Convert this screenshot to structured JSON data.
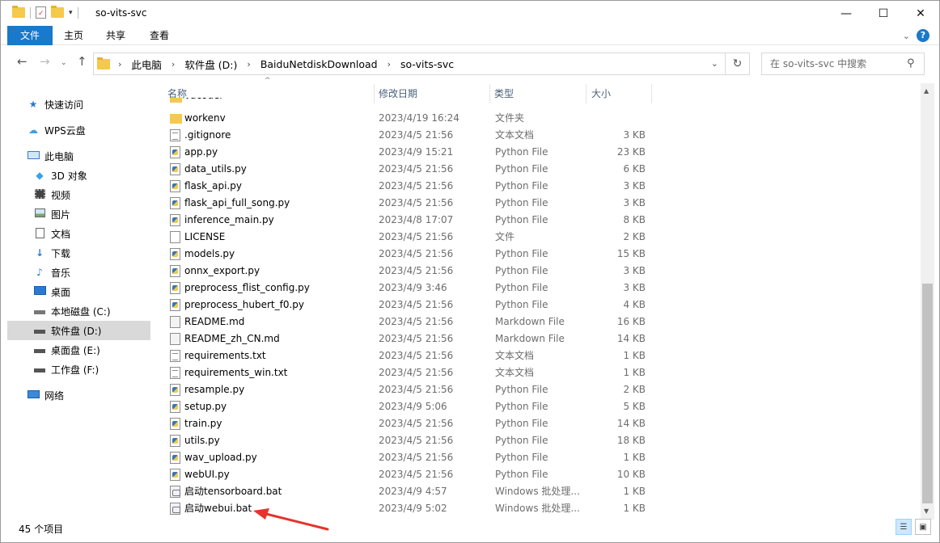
{
  "window": {
    "title": "so-vits-svc",
    "controls": [
      "—",
      "☐",
      "✕"
    ]
  },
  "ribbon": {
    "tabs": [
      "文件",
      "主页",
      "共享",
      "查看"
    ]
  },
  "address": {
    "crumbs": [
      "此电脑",
      "软件盘 (D:)",
      "BaiduNetdiskDownload",
      "so-vits-svc"
    ]
  },
  "search": {
    "placeholder": "在 so-vits-svc 中搜索"
  },
  "sidebar": {
    "items": [
      {
        "label": "快速访问",
        "icon": "star-icon"
      },
      {
        "label": "WPS云盘",
        "icon": "cloud-icon"
      },
      {
        "label": "此电脑",
        "icon": "computer-icon"
      },
      {
        "label": "3D 对象",
        "icon": "cube-icon"
      },
      {
        "label": "视频",
        "icon": "video-icon"
      },
      {
        "label": "图片",
        "icon": "picture-icon"
      },
      {
        "label": "文档",
        "icon": "document-icon"
      },
      {
        "label": "下载",
        "icon": "download-icon"
      },
      {
        "label": "音乐",
        "icon": "music-icon"
      },
      {
        "label": "桌面",
        "icon": "desktop-icon"
      },
      {
        "label": "本地磁盘 (C:)",
        "icon": "drive-icon"
      },
      {
        "label": "软件盘 (D:)",
        "icon": "drive-icon"
      },
      {
        "label": "桌面盘 (E:)",
        "icon": "drive-icon"
      },
      {
        "label": "工作盘 (F:)",
        "icon": "drive-icon"
      },
      {
        "label": "网络",
        "icon": "network-icon"
      }
    ]
  },
  "columns": {
    "name": "名称",
    "date": "修改日期",
    "type": "类型",
    "size": "大小"
  },
  "files": [
    {
      "name": "workenv",
      "date": "2023/4/19 16:24",
      "type": "文件夹",
      "size": "",
      "icon": "folder"
    },
    {
      "name": ".gitignore",
      "date": "2023/4/5 21:56",
      "type": "文本文档",
      "size": "3 KB",
      "icon": "txt"
    },
    {
      "name": "app.py",
      "date": "2023/4/9 15:21",
      "type": "Python File",
      "size": "23 KB",
      "icon": "py"
    },
    {
      "name": "data_utils.py",
      "date": "2023/4/5 21:56",
      "type": "Python File",
      "size": "6 KB",
      "icon": "py"
    },
    {
      "name": "flask_api.py",
      "date": "2023/4/5 21:56",
      "type": "Python File",
      "size": "3 KB",
      "icon": "py"
    },
    {
      "name": "flask_api_full_song.py",
      "date": "2023/4/5 21:56",
      "type": "Python File",
      "size": "3 KB",
      "icon": "py"
    },
    {
      "name": "inference_main.py",
      "date": "2023/4/8 17:07",
      "type": "Python File",
      "size": "8 KB",
      "icon": "py"
    },
    {
      "name": "LICENSE",
      "date": "2023/4/5 21:56",
      "type": "文件",
      "size": "2 KB",
      "icon": "blank"
    },
    {
      "name": "models.py",
      "date": "2023/4/5 21:56",
      "type": "Python File",
      "size": "15 KB",
      "icon": "py"
    },
    {
      "name": "onnx_export.py",
      "date": "2023/4/5 21:56",
      "type": "Python File",
      "size": "3 KB",
      "icon": "py"
    },
    {
      "name": "preprocess_flist_config.py",
      "date": "2023/4/9 3:46",
      "type": "Python File",
      "size": "3 KB",
      "icon": "py"
    },
    {
      "name": "preprocess_hubert_f0.py",
      "date": "2023/4/5 21:56",
      "type": "Python File",
      "size": "4 KB",
      "icon": "py"
    },
    {
      "name": "README.md",
      "date": "2023/4/5 21:56",
      "type": "Markdown File",
      "size": "16 KB",
      "icon": "md"
    },
    {
      "name": "README_zh_CN.md",
      "date": "2023/4/5 21:56",
      "type": "Markdown File",
      "size": "14 KB",
      "icon": "md"
    },
    {
      "name": "requirements.txt",
      "date": "2023/4/5 21:56",
      "type": "文本文档",
      "size": "1 KB",
      "icon": "txt"
    },
    {
      "name": "requirements_win.txt",
      "date": "2023/4/5 21:56",
      "type": "文本文档",
      "size": "1 KB",
      "icon": "txt"
    },
    {
      "name": "resample.py",
      "date": "2023/4/5 21:56",
      "type": "Python File",
      "size": "2 KB",
      "icon": "py"
    },
    {
      "name": "setup.py",
      "date": "2023/4/9 5:06",
      "type": "Python File",
      "size": "5 KB",
      "icon": "py"
    },
    {
      "name": "train.py",
      "date": "2023/4/5 21:56",
      "type": "Python File",
      "size": "14 KB",
      "icon": "py"
    },
    {
      "name": "utils.py",
      "date": "2023/4/5 21:56",
      "type": "Python File",
      "size": "18 KB",
      "icon": "py"
    },
    {
      "name": "wav_upload.py",
      "date": "2023/4/5 21:56",
      "type": "Python File",
      "size": "1 KB",
      "icon": "py"
    },
    {
      "name": "webUI.py",
      "date": "2023/4/5 21:56",
      "type": "Python File",
      "size": "10 KB",
      "icon": "py"
    },
    {
      "name": "启动tensorboard.bat",
      "date": "2023/4/9 4:57",
      "type": "Windows 批处理...",
      "size": "1 KB",
      "icon": "bat"
    },
    {
      "name": "启动webui.bat",
      "date": "2023/4/9 5:02",
      "type": "Windows 批处理...",
      "size": "1 KB",
      "icon": "bat"
    }
  ],
  "status": {
    "count": "45 个项目"
  },
  "colors": {
    "accent": "#1979ca",
    "arrow": "#e8322b"
  }
}
